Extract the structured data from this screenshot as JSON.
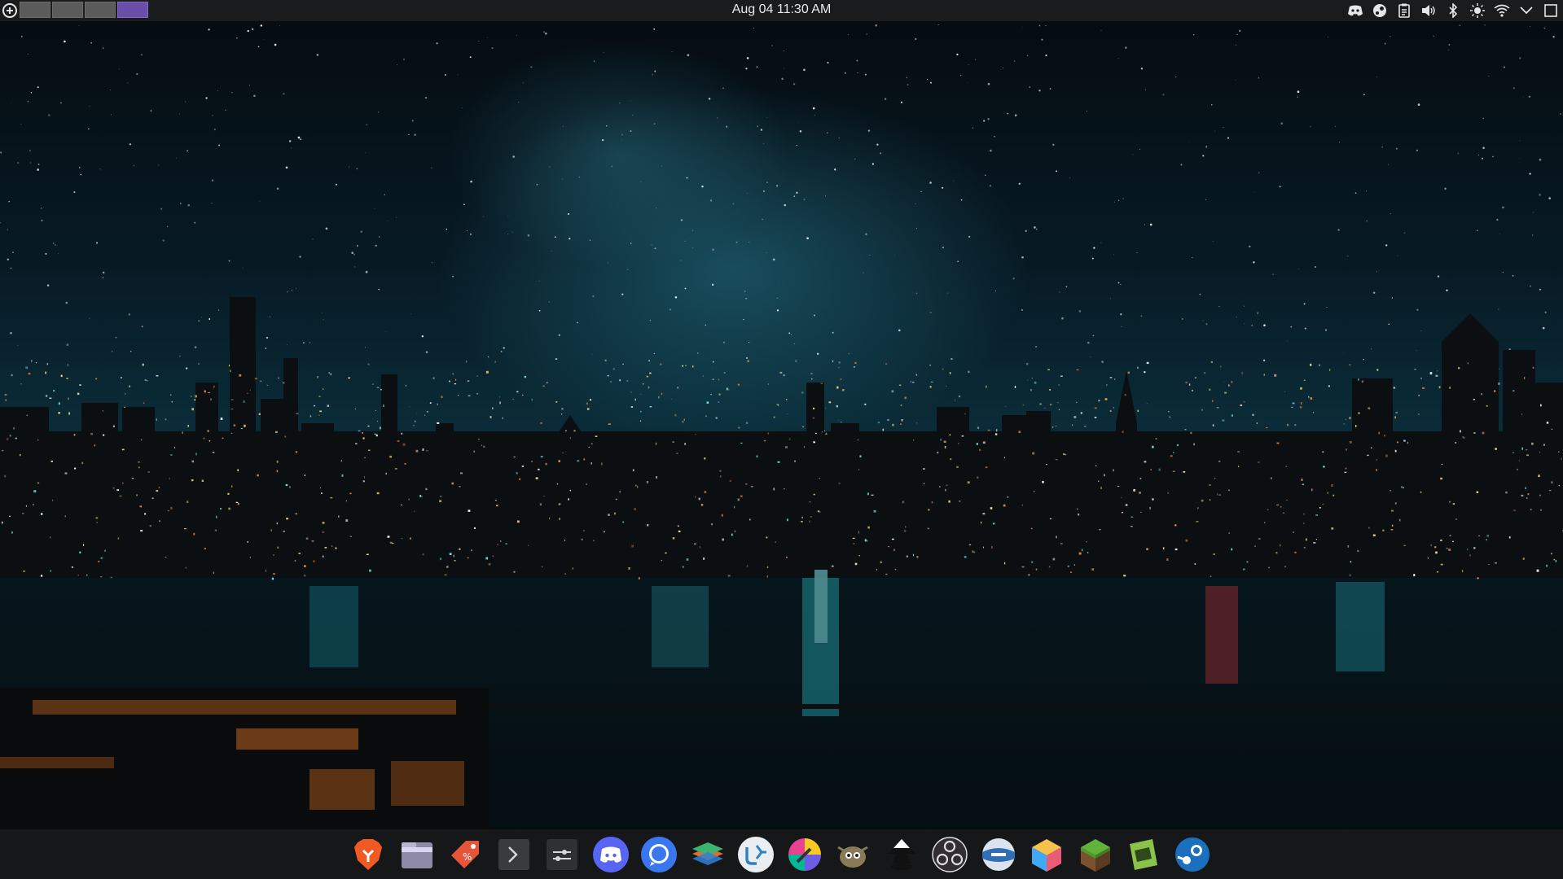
{
  "top_panel": {
    "clock": "Aug 04 11:30 AM",
    "virtual_desktops": [
      {
        "active": false
      },
      {
        "active": false
      },
      {
        "active": false
      },
      {
        "active": true
      }
    ],
    "tray_icons": [
      "discord-icon",
      "steam-icon",
      "clipboard-icon",
      "volume-icon",
      "bluetooth-icon",
      "brightness-icon",
      "wifi-icon",
      "chevron-down-icon",
      "show-desktop-icon"
    ]
  },
  "dock": {
    "apps": [
      "brave-browser-icon",
      "file-manager-icon",
      "discount-tag-icon",
      "terminal-icon",
      "system-settings-icon",
      "discord-icon",
      "signal-icon",
      "layers-stack-icon",
      "kdevelop-icon",
      "color-picker-icon",
      "gimp-icon",
      "inkscape-icon",
      "obs-studio-icon",
      "bottles-icon",
      "cube-icon",
      "minecraft-icon",
      "itch-icon",
      "steam-icon"
    ]
  },
  "colors": {
    "panel_bg": "#1a1b1d",
    "active_desktop": "#6a4fa8"
  }
}
